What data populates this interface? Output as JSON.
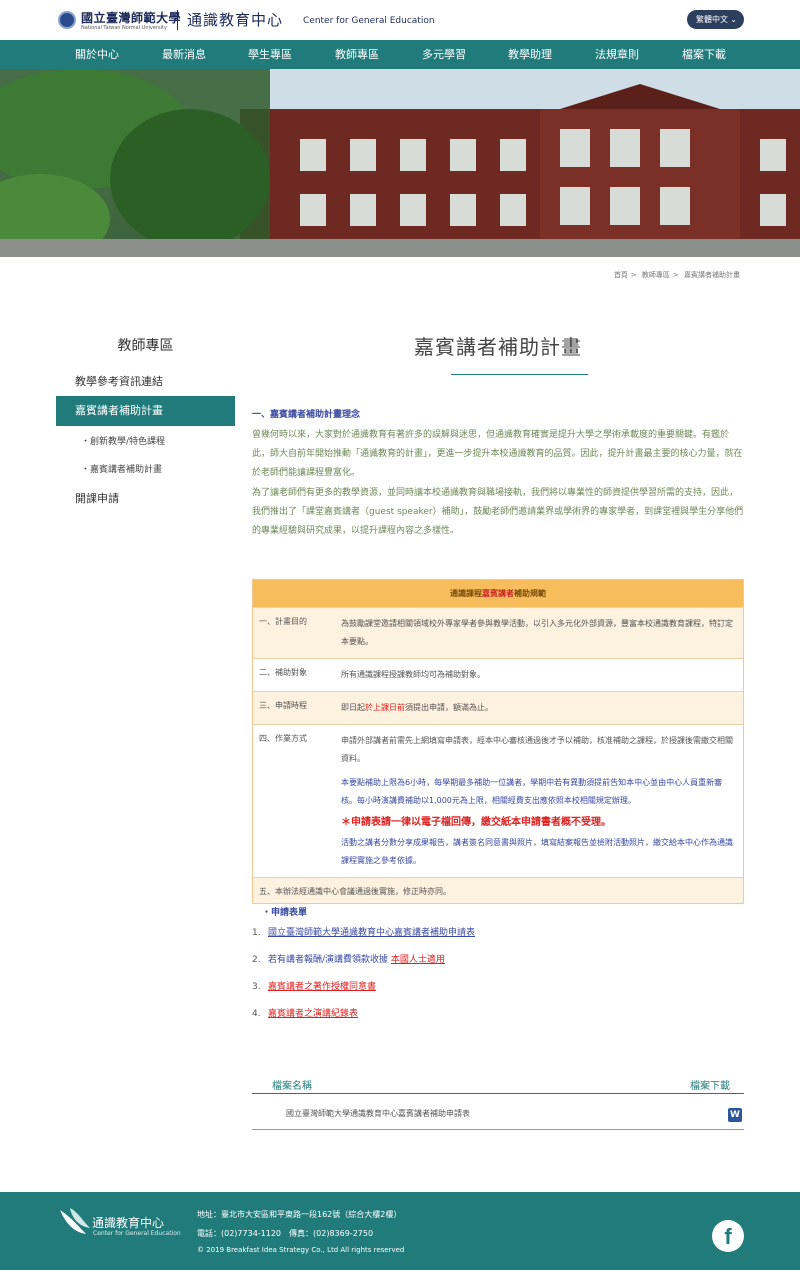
{
  "header": {
    "univ_name": "國立臺灣師範大學",
    "univ_name_en": "National Taiwan Normal University",
    "center_name": "通識教育中心",
    "center_name_en": "Center for General Education",
    "language_label": "繁體中文"
  },
  "nav": [
    {
      "label": "關於中心"
    },
    {
      "label": "最新消息"
    },
    {
      "label": "學生專區"
    },
    {
      "label": "教師專區"
    },
    {
      "label": "多元學習"
    },
    {
      "label": "教學助理"
    },
    {
      "label": "法規章則"
    },
    {
      "label": "檔案下載"
    }
  ],
  "breadcrumb": [
    "首頁",
    "教師專區",
    "嘉賓講者補助計畫"
  ],
  "sidebar": {
    "title": "教師專區",
    "items": [
      {
        "label": "教學參考資訊連結"
      },
      {
        "label": "嘉賓講者補助計畫"
      },
      {
        "label": "創新教學/特色課程"
      },
      {
        "label": "嘉賓講者補助計畫"
      },
      {
        "label": "開課申請"
      }
    ]
  },
  "page_title": "嘉賓講者補助計畫",
  "section1": {
    "heading": "一、嘉賓講者補助計畫理念",
    "para1": "曾幾何時以來，大家對於通識教育有著許多的誤解與迷思，但通識教育確實是提升大學之學術承載度的重要關鍵。有鑑於此，師大自前年開始推動「通識教育的計畫」，更進一步提升本校通識教育的品質。因此，提升計畫最主要的核心力量，就在於老師們能讓課程豐富化。",
    "para2": "為了讓老師們有更多的教學資源，並同時讓本校通識教育與職場接軌，我們將以專業性的師資提供學習所需的支持，因此，我們推出了「課堂嘉賓講者（guest speaker）補助」，鼓勵老師們邀請業界或學術界的專家學者，到課堂裡與學生分享他們的專業經驗與研究成果，以提升課程內容之多樣性。"
  },
  "table": {
    "header_pre": "通識課程",
    "header_hl": "嘉賓講者",
    "header_post": "補助規範",
    "rows": [
      {
        "label": "一、計畫目的",
        "lines": [
          "為鼓勵課堂邀請相關領域校外專家學者參與教學活動，以引入多元化外部資源，豐富本校通識教育課程，特訂定本要點。"
        ]
      },
      {
        "label": "二、補助對象",
        "lines": [
          "所有通識課程授課教師均可為補助對象。"
        ]
      },
      {
        "label": "三、申請時程",
        "pre": "即日起",
        "hl": "於上課日前",
        "post": "須提出申請，額滿為止。"
      },
      {
        "label": "四、作業方式",
        "lines": [
          "申請外部講者前需先上網填寫申請表，經本中心審核通過後才予以補助，核准補助之課程，於授課後需繳交相關資料。",
          "本要點補助上限為6小時，每學期最多補助一位講者，學期中若有異動須提前告知本中心並由中心人員重新審核。每小時演講費補助以1,000元為上限，相關經費支出應依照本校相關規定辦理。"
        ],
        "notice": "＊申請表請一律以電子檔回傳，繳交紙本申請書者概不受理。",
        "lines2": [
          "活動之講者分數分享成果報告，講者簽名同意書與照片，填寫結案報告並檢附活動照片，繳交給本中心作為通識課程實施之參考依據。"
        ]
      },
      {
        "label": "五、本辦法經通識中心會議通過後實施，修正時亦同。",
        "lines": []
      }
    ]
  },
  "application": {
    "heading": "・申請表單",
    "items": [
      {
        "num": "1.",
        "text": "國立臺灣師範大學通識教育中心嘉賓講者補助申請表",
        "color": "#3a4aa0"
      },
      {
        "num": "2.",
        "pre": "若有講者報酬/演講費領款收據",
        "link": "本國人士適用",
        "color": "#3a4aa0"
      },
      {
        "num": "3.",
        "text": "嘉賓講者之著作授權同意書",
        "color": "#d22"
      },
      {
        "num": "4.",
        "text": "嘉賓講者之演講紀錄表",
        "color": "#d22"
      }
    ]
  },
  "files": {
    "col_name": "檔案名稱",
    "col_download": "檔案下載",
    "rows": [
      {
        "name": "國立臺灣師範大學通識教育中心嘉賓講者補助申請表",
        "icon": "word-icon"
      }
    ]
  },
  "footer": {
    "logo_cn": "通識教育中心",
    "logo_en": "Center for General Education",
    "address": "地址：臺北市大安區和平東路一段162號（綜合大樓2樓）",
    "phone": "電話：(02)7734-1120　傳真：(02)8369-2750",
    "copyright": "© 2019 Breakfast Idea Strategy Co., Ltd All rights reserved"
  },
  "colors": {
    "primary": "#227b7b",
    "accent_orange": "#f7bd5c",
    "text_blue": "#3a4aa0",
    "text_red": "#d22"
  }
}
